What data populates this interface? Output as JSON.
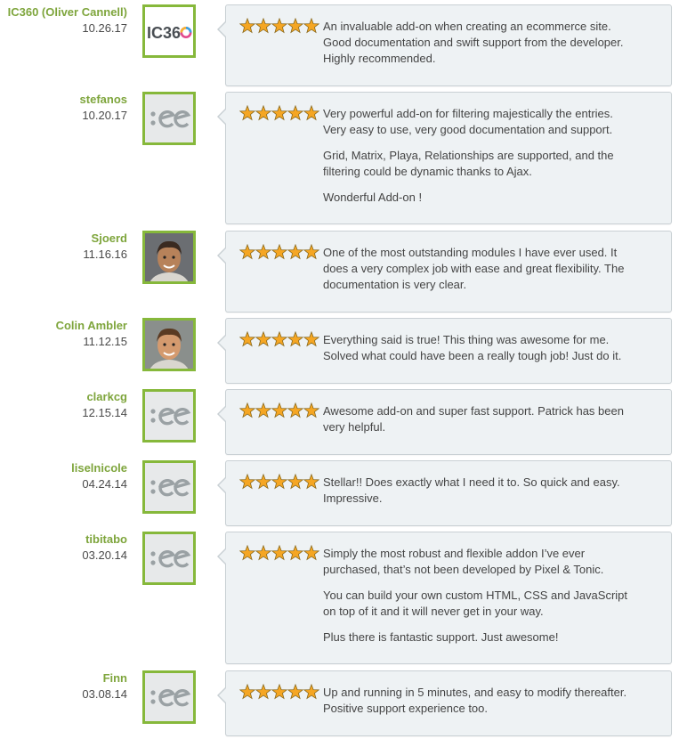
{
  "colors": {
    "author": "#7ea53c",
    "avatar_border": "#86b83b",
    "star": "#f5a623",
    "bubble_bg": "#eef2f4"
  },
  "reviews": [
    {
      "author": "IC360 (Oliver Cannell)",
      "date": "10.26.17",
      "avatar": "ic360-logo",
      "rating": 5,
      "paragraphs": [
        "An invaluable add-on when creating an ecommerce site. Good documentation and swift support from the developer. Highly recommended."
      ]
    },
    {
      "author": "stefanos",
      "date": "10.20.17",
      "avatar": "ee-logo",
      "rating": 5,
      "paragraphs": [
        "Very powerful add-on for filtering majestically the entries. Very easy to use, very good documentation and support.",
        "Grid, Matrix, Playa, Relationships are supported, and the filtering could be dynamic thanks to Ajax.",
        "Wonderful Add-on !"
      ]
    },
    {
      "author": "Sjoerd",
      "date": "11.16.16",
      "avatar": "user-photo",
      "rating": 5,
      "paragraphs": [
        "One of the most outstanding modules I have ever used. It does a very complex job with ease and great flexibility. The documentation is very clear."
      ]
    },
    {
      "author": "Colin Ambler",
      "date": "11.12.15",
      "avatar": "user-photo",
      "rating": 5,
      "paragraphs": [
        "Everything said is true!  This thing was awesome for me. Solved what could have been a really tough job!  Just do it."
      ]
    },
    {
      "author": "clarkcg",
      "date": "12.15.14",
      "avatar": "ee-logo",
      "rating": 5,
      "paragraphs": [
        "Awesome add-on and super fast support. Patrick has been very helpful."
      ]
    },
    {
      "author": "liselnicole",
      "date": "04.24.14",
      "avatar": "ee-logo",
      "rating": 5,
      "paragraphs": [
        "Stellar!! Does exactly what I need it to. So quick and easy. Impressive."
      ]
    },
    {
      "author": "tibitabo",
      "date": "03.20.14",
      "avatar": "ee-logo",
      "rating": 5,
      "paragraphs": [
        "Simply the most robust and flexible addon I’ve ever purchased, that’s not been developed by Pixel & Tonic.",
        "You can build your own custom HTML, CSS and JavaScript on top of it and it will never get in your way.",
        "Plus there is fantastic support. Just awesome!"
      ]
    },
    {
      "author": "Finn",
      "date": "03.08.14",
      "avatar": "ee-logo",
      "rating": 5,
      "paragraphs": [
        "Up and running in 5 minutes, and easy to modify thereafter. Positive support experience too."
      ]
    }
  ]
}
